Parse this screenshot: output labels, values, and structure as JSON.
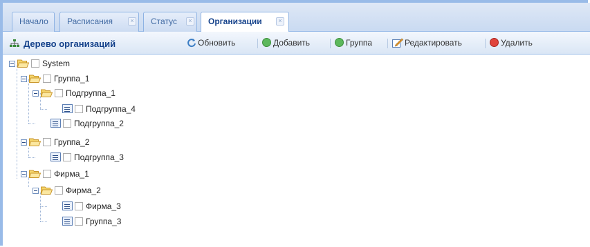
{
  "tabs": [
    {
      "label": "Начало",
      "closable": false
    },
    {
      "label": "Расписания",
      "closable": true
    },
    {
      "label": "Статус",
      "closable": true
    },
    {
      "label": "Организации",
      "closable": true,
      "active": true
    }
  ],
  "panel": {
    "title": "Дерево организаций",
    "title_icon": "org-tree-icon"
  },
  "toolbar": {
    "refresh_label": "Обновить",
    "add_label": "Добавить",
    "group_label": "Группа",
    "edit_label": "Редактировать",
    "delete_label": "Удалить"
  },
  "tree": {
    "root": "System",
    "group1": "Группа_1",
    "subgroup1": "Подгруппа_1",
    "subgroup4": "Подгруппа_4",
    "subgroup2": "Подгруппа_2",
    "group2": "Группа_2",
    "subgroup3": "Подгруппа_3",
    "firm1": "Фирма_1",
    "firm2": "Фирма_2",
    "firm3": "Фирма_3",
    "group3": "Группа_3"
  },
  "colors": {
    "accent": "#99bbe8",
    "title": "#15428b",
    "add": "#5cb85c",
    "delete": "#e0443c",
    "folder": "#f5d56b"
  }
}
